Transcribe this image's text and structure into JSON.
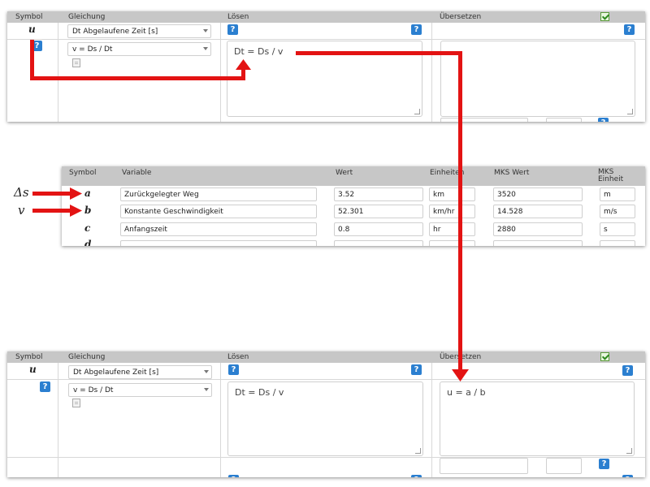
{
  "equation_panel_top": {
    "headers": {
      "symbol": "Symbol",
      "equation": "Gleichung",
      "solve": "Lösen",
      "translate": "Übersetzen"
    },
    "symbol": "u",
    "variable_select": "Dt Abgelaufene Zeit [s]",
    "equation_select": "v = Ds / Dt",
    "solve_text": "Dt = Ds / v",
    "translate_text": "",
    "help_glyph": "?"
  },
  "variables_table": {
    "headers": {
      "symbol": "Symbol",
      "variable": "Variable",
      "value": "Wert",
      "units": "Einheiten",
      "mks_value": "MKS Wert",
      "mks_unit": "MKS Einheit"
    },
    "rows": [
      {
        "symbol": "a",
        "variable": "Zurückgelegter Weg",
        "value": "3.52",
        "unit": "km",
        "mks_value": "3520",
        "mks_unit": "m"
      },
      {
        "symbol": "b",
        "variable": "Konstante Geschwindigkeit",
        "value": "52.301",
        "unit": "km/hr",
        "mks_value": "14.528",
        "mks_unit": "m/s"
      },
      {
        "symbol": "c",
        "variable": "Anfangszeit",
        "value": "0.8",
        "unit": "hr",
        "mks_value": "2880",
        "mks_unit": "s"
      },
      {
        "symbol": "d",
        "variable": "",
        "value": "",
        "unit": "",
        "mks_value": "",
        "mks_unit": ""
      }
    ]
  },
  "equation_panel_bottom": {
    "headers": {
      "symbol": "Symbol",
      "equation": "Gleichung",
      "solve": "Lösen",
      "translate": "Übersetzen"
    },
    "symbol": "u",
    "variable_select": "Dt Abgelaufene Zeit [s]",
    "equation_select": "v = Ds / Dt",
    "solve_text": "Dt = Ds / v",
    "translate_text": "u = a / b",
    "help_glyph": "?"
  },
  "annotations": {
    "delta_s": "Δs",
    "v": "v"
  },
  "colors": {
    "arrow": "#e31313",
    "header_bg": "#c7c7c7",
    "help_blue": "#2b7fd0",
    "check_green": "#2f8a1f"
  }
}
